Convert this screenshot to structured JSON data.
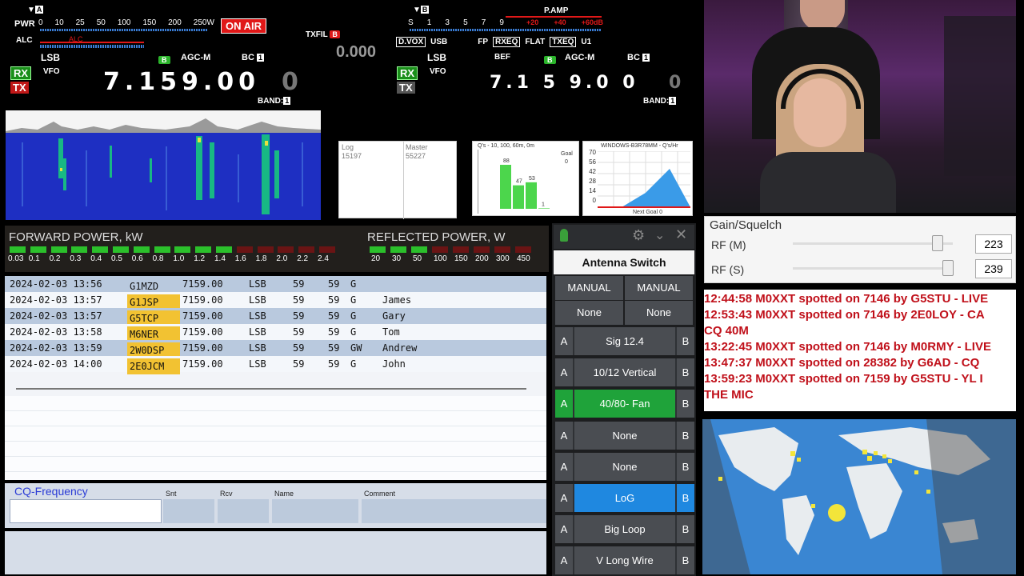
{
  "rig_left": {
    "pwr_label": "PWR",
    "pwr_scale": [
      "0",
      "10",
      "25",
      "50",
      "100",
      "150",
      "200",
      "250W"
    ],
    "vfo_tag": "A",
    "alc": "ALC",
    "alc_bar": "ALC",
    "on_air": "ON AIR",
    "mode": "LSB",
    "agc_badge": "B",
    "agc": "AGC-M",
    "bc": "BC",
    "bc_num": "1",
    "rx": "RX",
    "tx": "TX",
    "vfo": "VFO",
    "freq": "7.159.00",
    "freq_last": "0",
    "band": "BAND:",
    "band_num": "1"
  },
  "rig_mid": {
    "txfil": "TXFIL",
    "txfil_badge": "B",
    "offset": "0.000"
  },
  "rig_right": {
    "vfo_tag": "B",
    "s_scale": [
      "S",
      "1",
      "3",
      "5",
      "7",
      "9"
    ],
    "plus": [
      "+20",
      "+40",
      "+60dB"
    ],
    "pamp": "P.AMP",
    "dvox": "D.VOX",
    "usb": "USB",
    "fp": "FP",
    "rxeq": "RXEQ",
    "flat": "FLAT",
    "txeq": "TXEQ",
    "u1": "U1",
    "mode": "LSB",
    "bef": "BEF",
    "agc_badge": "B",
    "agc": "AGC-M",
    "bc": "BC",
    "bc_num": "1",
    "rx": "RX",
    "tx": "TX",
    "vfo": "VFO",
    "freq": "7.1 5 9.0 0",
    "freq_last": "0",
    "band": "BAND:",
    "band_num": "1"
  },
  "log_counts": {
    "log_label": "Log",
    "log_value": "15197",
    "master_label": "Master",
    "master_value": "55227"
  },
  "qso_chart": {
    "title": "Q's - 10, 100, 60m, 0m",
    "goal_label": "Goal",
    "goal_value": "0",
    "bars": [
      88,
      47,
      53,
      1
    ],
    "bar_labels": [
      "88",
      "47",
      "53",
      "1"
    ]
  },
  "rate_chart": {
    "title": "WINDOWS-B3R78MM - Q's/Hr",
    "yticks": [
      "70",
      "56",
      "42",
      "28",
      "14",
      "0"
    ],
    "footer": "Next Goal 0"
  },
  "power": {
    "fwd_title": "FORWARD POWER, kW",
    "fwd_scale": [
      "0.03",
      "0.1",
      "0.2",
      "0.3",
      "0.4",
      "0.5",
      "0.6",
      "0.8",
      "1.0",
      "1.2",
      "1.4",
      "1.6",
      "1.8",
      "2.0",
      "2.2",
      "2.4"
    ],
    "ref_title": "REFLECTED POWER, W",
    "ref_scale": [
      "20",
      "30",
      "50",
      "100",
      "150",
      "200",
      "300",
      "450"
    ]
  },
  "log_rows": [
    {
      "date": "2024-02-03 13:56",
      "call": "G1MZD",
      "freq": "7159.00",
      "mode": "LSB",
      "snt": "59",
      "rcv": "59",
      "cty": "G",
      "name": ""
    },
    {
      "date": "2024-02-03 13:57",
      "call": "G1JSP",
      "freq": "7159.00",
      "mode": "LSB",
      "snt": "59",
      "rcv": "59",
      "cty": "G",
      "name": "James"
    },
    {
      "date": "2024-02-03 13:57",
      "call": "G5TCP",
      "freq": "7159.00",
      "mode": "LSB",
      "snt": "59",
      "rcv": "59",
      "cty": "G",
      "name": "Gary"
    },
    {
      "date": "2024-02-03 13:58",
      "call": "M6NER",
      "freq": "7159.00",
      "mode": "LSB",
      "snt": "59",
      "rcv": "59",
      "cty": "G",
      "name": "Tom"
    },
    {
      "date": "2024-02-03 13:59",
      "call": "2W0DSP",
      "freq": "7159.00",
      "mode": "LSB",
      "snt": "59",
      "rcv": "59",
      "cty": "GW",
      "name": "Andrew"
    },
    {
      "date": "2024-02-03 14:00",
      "call": "2E0JCM",
      "freq": "7159.00",
      "mode": "LSB",
      "snt": "59",
      "rcv": "59",
      "cty": "G",
      "name": "John"
    }
  ],
  "entry": {
    "cq_label": "CQ-Frequency",
    "snt": "Snt",
    "rcv": "Rcv",
    "name": "Name",
    "comment": "Comment"
  },
  "antenna": {
    "title": "Antenna Switch",
    "manual1": "MANUAL",
    "manual2": "MANUAL",
    "none1": "None",
    "none2": "None",
    "a": "A",
    "b": "B",
    "items": [
      "Sig 12.4",
      "10/12 Vertical",
      "40/80- Fan",
      "None",
      "None",
      "LoG",
      "Big Loop",
      "V Long Wire"
    ]
  },
  "gain": {
    "title": "Gain/Squelch",
    "rf_m": "RF (M)",
    "rf_m_val": "223",
    "rf_s": "RF (S)",
    "rf_s_val": "239"
  },
  "spots": [
    "12:44:58 M0XXT spotted on 7146 by G5STU - LIVE",
    "12:53:43 M0XXT spotted on 7146 by 2E0LOY - CA",
    "CQ 40M",
    "13:22:45 M0XXT spotted on 7146 by M0RMY - LIVE",
    "13:47:37 M0XXT spotted on 28382 by G6AD - CQ",
    "13:59:23 M0XXT spotted on 7159 by G5STU - YL I",
    "THE MIC"
  ],
  "colors": {
    "accent_green": "#2bb52b",
    "on_air_red": "#e01818",
    "call_highlight": "#f2c232",
    "lsb_row": "#b9c9de",
    "antenna_active": "#1fa33a",
    "antenna_log": "#1f88e0",
    "spot_red": "#c0101a"
  }
}
